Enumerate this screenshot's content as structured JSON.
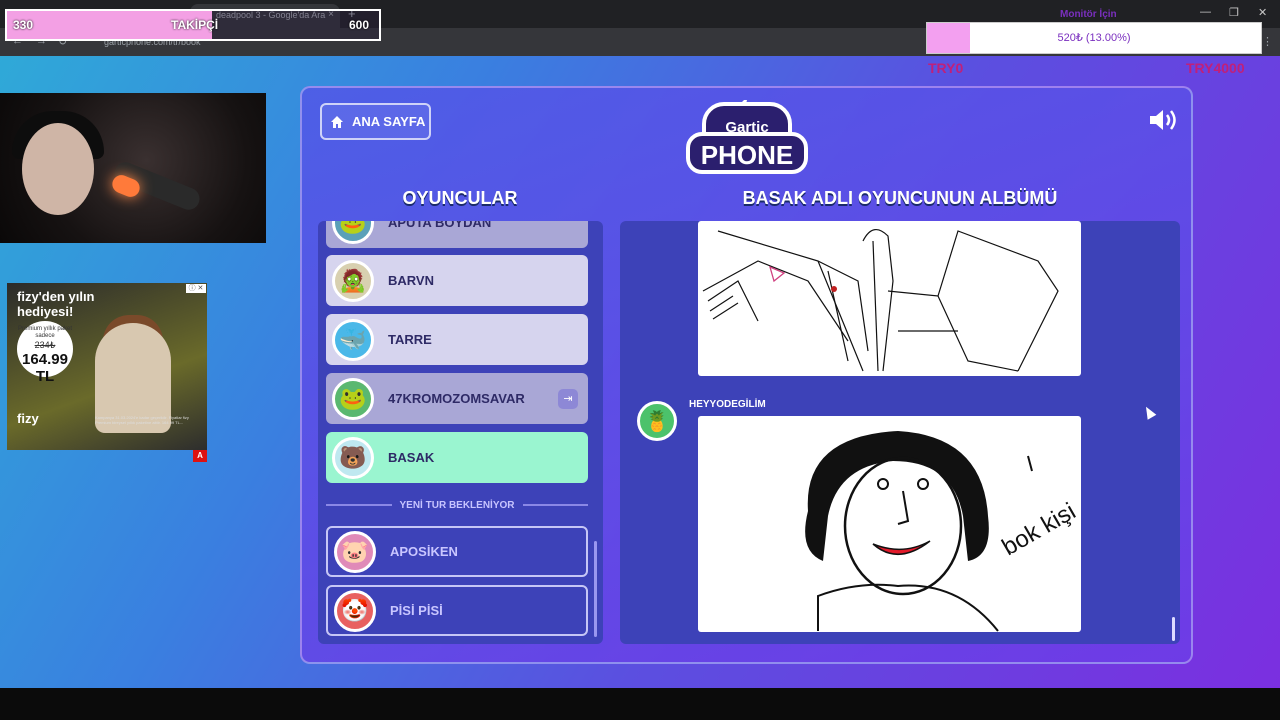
{
  "browser": {
    "tab_title": "deadpool 3 - Google'da Ara",
    "url": "garticphone.com/tr/book",
    "new_tab": "+",
    "close_tab": "×"
  },
  "overlay": {
    "followers": {
      "current": "330",
      "label": "TAKİPÇİ",
      "goal": "600",
      "progress": 0.55
    },
    "monitor": {
      "title": "Monitör İçin",
      "amount": "520₺ (13.00%)",
      "progress": 0.13,
      "start": "TRY0",
      "end": "TRY4000"
    }
  },
  "ad": {
    "headline": "fizy'den yılın hediyesi!",
    "promo": "Premium yıllık paket sadece",
    "old_price": "234₺",
    "price": "164.99 TL",
    "brand": "fizy",
    "badge": "A",
    "fine_print": "Kampanya 31.03.2024'e kadar geçerlidir. Fiyatlar fizy Premium bireysel yıllık paketine aittir. 164.99 TL..."
  },
  "game": {
    "home_label": "ANA SAYFA",
    "logo_top": "Gartic",
    "logo_bottom": "PHONE",
    "players_title": "OYUNCULAR",
    "album_title": "BASAK ADLI OYUNCUNUN ALBÜMÜ",
    "players": [
      {
        "name": "APUTA BOYDAN",
        "emoji": "🐸"
      },
      {
        "name": "BARVN",
        "emoji": "🧟"
      },
      {
        "name": "TARRE",
        "emoji": "🐳"
      },
      {
        "name": "47KROMOZOMSAVAR",
        "emoji": "🐸"
      },
      {
        "name": "BASAK",
        "emoji": "🐻"
      }
    ],
    "waiting_label": "YENİ TUR BEKLENİYOR",
    "waiting_players": [
      {
        "name": "APOSİKEN",
        "emoji": "🐷"
      },
      {
        "name": "PİSİ PİSİ",
        "emoji": "🤡"
      }
    ],
    "album_author": "HEYYODEGİLİM",
    "album_author_emoji": "🍍",
    "sketch_text": "bok kişi"
  },
  "colors": {
    "accent": "#9af5d0",
    "panel": "#3d42b8",
    "follow": "#f3a0e4",
    "donate": "#f3a0f0"
  }
}
